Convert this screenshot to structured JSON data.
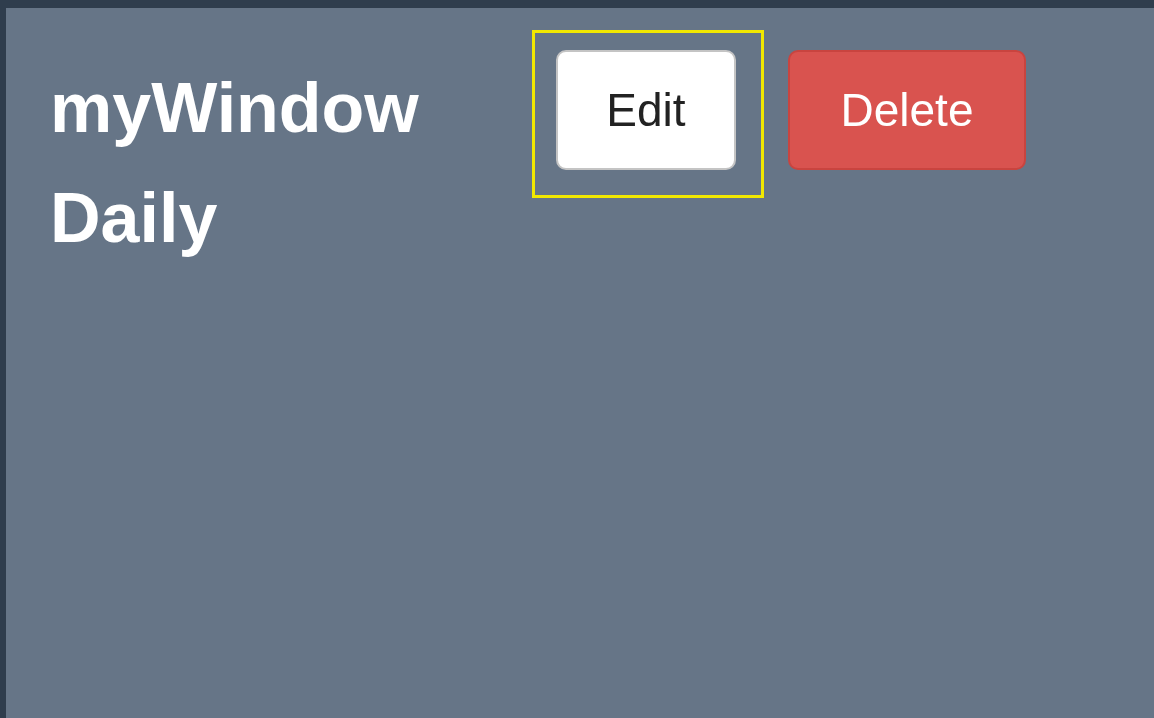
{
  "titles": [
    "myWindow",
    "Daily"
  ],
  "buttons": [
    {
      "label": "Edit",
      "kind": "default",
      "highlighted": true
    },
    {
      "label": "Delete",
      "kind": "danger",
      "highlighted": false
    }
  ]
}
